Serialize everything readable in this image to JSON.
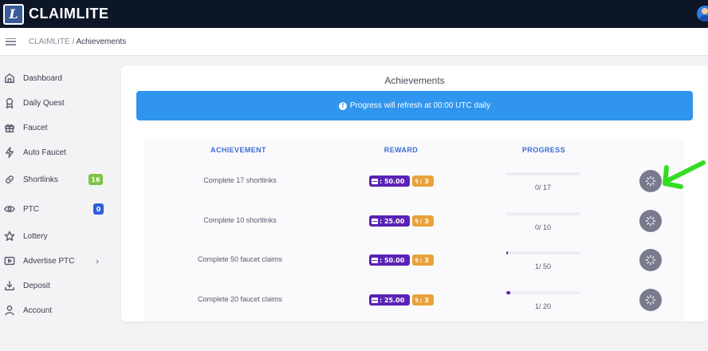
{
  "header": {
    "logo_letter": "L",
    "brand": "CLAIMLITE"
  },
  "breadcrumb": {
    "root": "CLAIMLITE",
    "separator": " / ",
    "current": "Achievements"
  },
  "sidebar": {
    "items": [
      {
        "label": "Dashboard",
        "icon": "home-icon"
      },
      {
        "label": "Daily Quest",
        "icon": "award-icon"
      },
      {
        "label": "Faucet",
        "icon": "gift-icon"
      },
      {
        "label": "Auto Faucet",
        "icon": "bolt-icon"
      },
      {
        "label": "Shortlinks",
        "icon": "link-icon",
        "badge": "16",
        "badge_color": "#7cc442"
      },
      {
        "label": "PTC",
        "icon": "eye-icon",
        "badge": "0",
        "badge_color": "#2f5fd8"
      },
      {
        "label": "Lottery",
        "icon": "star-icon"
      },
      {
        "label": "Advertise PTC",
        "icon": "play-icon",
        "chevron": "›"
      },
      {
        "label": "Deposit",
        "icon": "download-icon"
      },
      {
        "label": "Account",
        "icon": "user-icon"
      }
    ]
  },
  "main": {
    "title": "Achievements",
    "alert": "Progress will refresh at 00:00 UTC daily",
    "alert_color": "#2f95ee",
    "columns": [
      "ACHIEVEMENT",
      "REWARD",
      "PROGRESS"
    ],
    "rows": [
      {
        "achievement": "Complete 17 shortlinks",
        "tokens": ": 50.00",
        "energy": ": 3",
        "progress": "0/ 17",
        "progress_fraction": 0.0
      },
      {
        "achievement": "Complete 10 shortlinks",
        "tokens": ": 25.00",
        "energy": ": 3",
        "progress": "0/ 10",
        "progress_fraction": 0.0
      },
      {
        "achievement": "Complete 50 faucet claims",
        "tokens": ": 50.00",
        "energy": ": 3",
        "progress": "1/ 50",
        "progress_fraction": 0.02
      },
      {
        "achievement": "Complete 20 faucet claims",
        "tokens": ": 25.00",
        "energy": ": 3",
        "progress": "1/ 20",
        "progress_fraction": 0.05
      }
    ]
  },
  "colors": {
    "topbar": "#0d1626",
    "accent_purple": "#5a22b5",
    "energy_orange": "#e8a23b",
    "header_blue": "#3d6cd1",
    "annotation_arrow": "#33dd22"
  }
}
